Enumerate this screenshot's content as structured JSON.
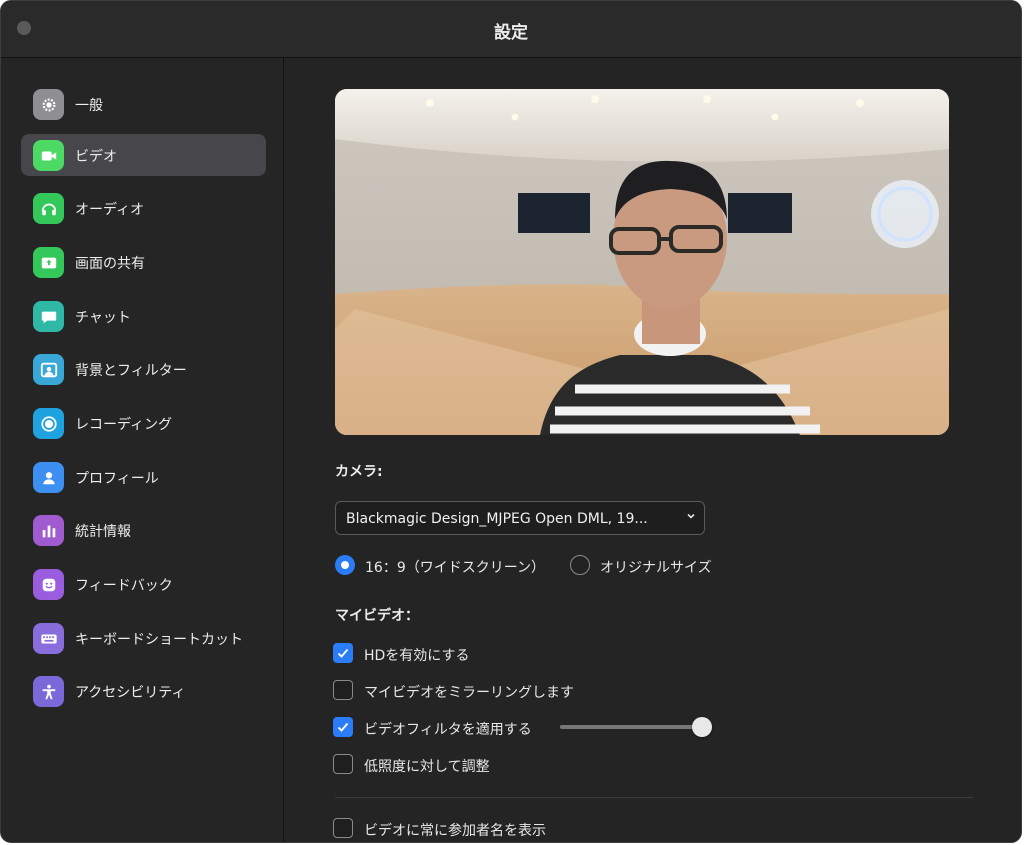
{
  "window": {
    "title": "設定"
  },
  "sidebar": {
    "items": [
      {
        "label": "一般",
        "icon": "gear-icon",
        "color": "#8e8e93",
        "selected": false
      },
      {
        "label": "ビデオ",
        "icon": "video-camera-icon",
        "color": "#4cd964",
        "selected": true
      },
      {
        "label": "オーディオ",
        "icon": "headphones-icon",
        "color": "#34c759",
        "selected": false
      },
      {
        "label": "画面の共有",
        "icon": "share-screen-icon",
        "color": "#34c759",
        "selected": false
      },
      {
        "label": "チャット",
        "icon": "chat-bubble-icon",
        "color": "#2fb8a6",
        "selected": false
      },
      {
        "label": "背景とフィルター",
        "icon": "background-portrait-icon",
        "color": "#3aa7d9",
        "selected": false
      },
      {
        "label": "レコーディング",
        "icon": "record-icon",
        "color": "#1fa2e0",
        "selected": false
      },
      {
        "label": "プロフィール",
        "icon": "person-icon",
        "color": "#3d8ff2",
        "selected": false
      },
      {
        "label": "統計情報",
        "icon": "bar-chart-icon",
        "color": "#a05bd1",
        "selected": false
      },
      {
        "label": "フィードバック",
        "icon": "smiley-icon",
        "color": "#9b5de0",
        "selected": false
      },
      {
        "label": "キーボードショートカット",
        "icon": "keyboard-icon",
        "color": "#8a6ddc",
        "selected": false
      },
      {
        "label": "アクセシビリティ",
        "icon": "accessibility-icon",
        "color": "#7b68d9",
        "selected": false
      }
    ]
  },
  "video": {
    "camera_label": "カメラ:",
    "camera_value": "Blackmagic Design_MJPEG Open DML, 19...",
    "aspect_options": [
      {
        "label": "16：9（ワイドスクリーン）",
        "selected": true
      },
      {
        "label": "オリジナルサイズ",
        "selected": false
      }
    ],
    "my_video_label": "マイビデオ：",
    "options": [
      {
        "label": "HDを有効にする",
        "checked": true
      },
      {
        "label": "マイビデオをミラーリングします",
        "checked": false
      },
      {
        "label": "ビデオフィルタを適用する",
        "checked": true
      },
      {
        "label": "低照度に対して調整",
        "checked": false
      },
      {
        "label": "ビデオに常に参加者名を表示",
        "checked": false
      }
    ],
    "filter_strength": 1.0
  },
  "colors": {
    "accent": "#2a7cf7",
    "selected_row": "#47474b"
  }
}
